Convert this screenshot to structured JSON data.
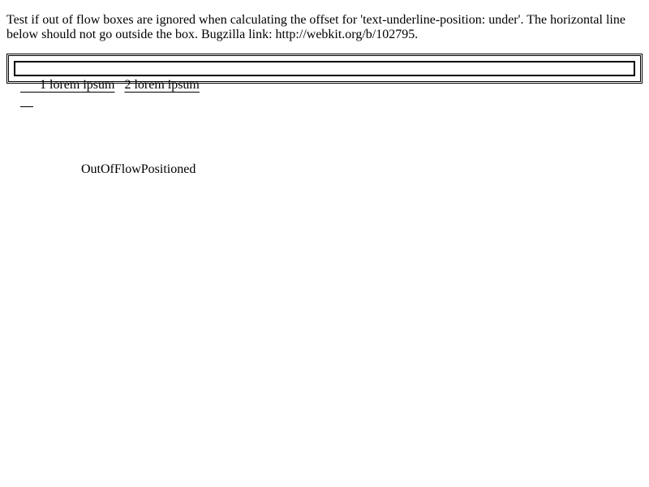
{
  "description": {
    "text": "Test if out of flow boxes are ignored when calculating the offset for 'text-underline-position: under'. The horizontal line below should not go outside the box. Bugzilla link: http://webkit.org/b/102795."
  },
  "box": {
    "item1": "1 lorem ipsum",
    "item2": "2 lorem ipsum"
  },
  "out_of_flow": {
    "label": "OutOfFlowPositioned"
  }
}
